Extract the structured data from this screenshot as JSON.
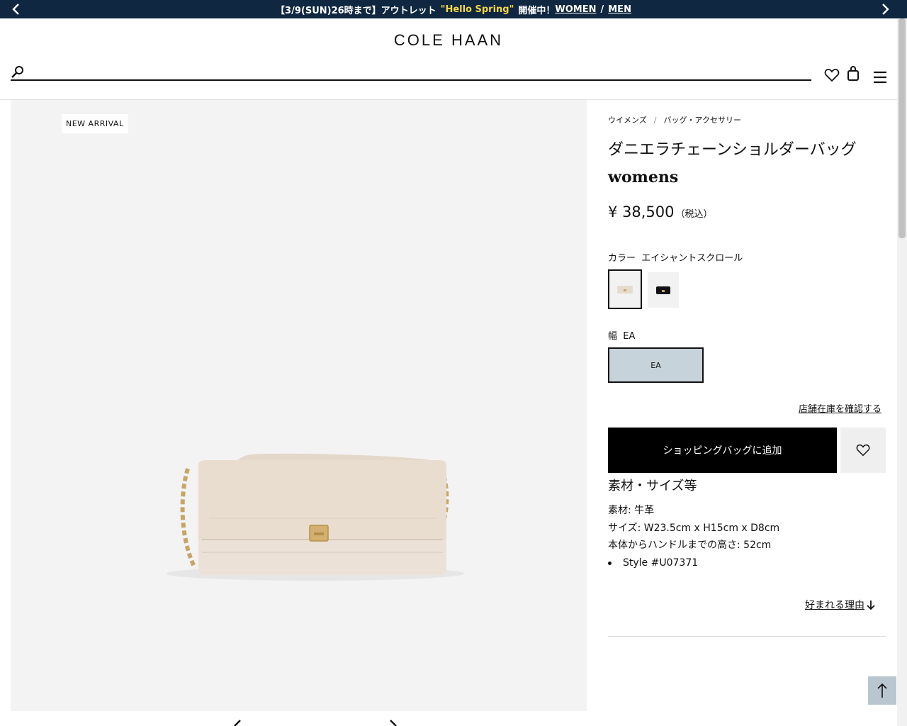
{
  "promo": {
    "prefix": "【3/9(SUN)26時まで】アウトレット",
    "highlight": "\"Hello Spring\"",
    "suffix": "開催中！",
    "women_link": "WOMEN",
    "separator": "/",
    "men_link": "MEN"
  },
  "header": {
    "logo": "COLE HAAN",
    "search_placeholder": ""
  },
  "gallery": {
    "badge": "NEW ARRIVAL"
  },
  "breadcrumb": {
    "items": [
      "ウイメンズ",
      "バッグ・アクセサリー"
    ],
    "separator": "/"
  },
  "product": {
    "title_ja": "ダニエラチェーンショルダーバッグ",
    "title_en": "womens",
    "price": "¥ 38,500",
    "tax_note": "（税込）",
    "color_label": "カラー",
    "color_value": "エイシャントスクロール",
    "swatches": [
      {
        "name": "エイシャントスクロール",
        "color": "#e8ddd2",
        "selected": true
      },
      {
        "name": "black",
        "color": "#111111",
        "selected": false
      }
    ],
    "width_label": "幅",
    "width_value": "EA",
    "width_option": "EA",
    "store_stock_link": "店舗在庫を確認する",
    "add_to_bag": "ショッピングバッグに追加"
  },
  "specs": {
    "heading": "素材・サイズ等",
    "material": "素材: 牛革",
    "size": "サイズ: W23.5cm x H15cm x D8cm",
    "handle_height": "本体からハンドルまでの高さ: 52cm",
    "style": "Style #U07371"
  },
  "reasons_link": "好まれる理由",
  "colors": {
    "promo_bg": "#0f2740",
    "promo_highlight": "#f5d742",
    "size_selected_bg": "#c7d3db",
    "add_button_bg": "#000000",
    "gallery_bg": "#f3f3f3",
    "to_top_bg": "#b9c6d0"
  }
}
